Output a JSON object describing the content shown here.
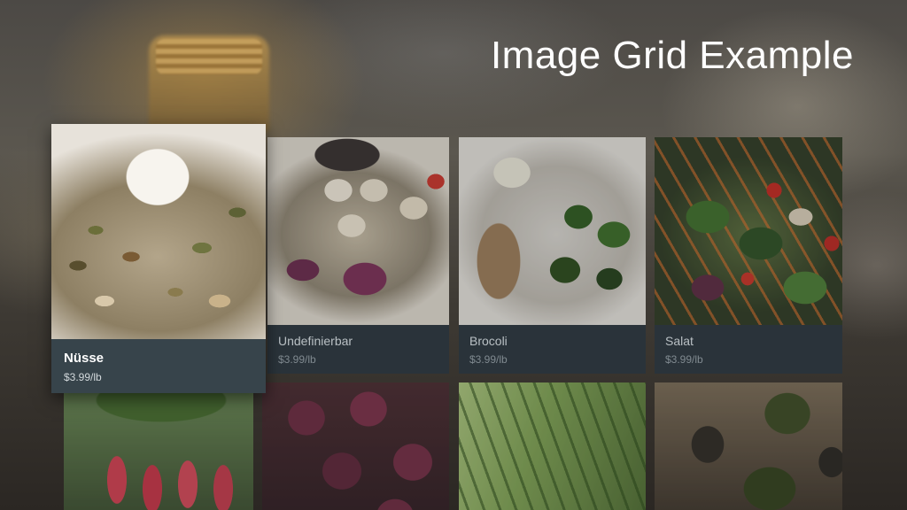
{
  "page": {
    "title": "Image Grid Example"
  },
  "grid": {
    "items": [
      {
        "title": "Nüsse",
        "price": "$3.99/lb",
        "image": "nuts-cheese-photo",
        "focused": true
      },
      {
        "title": "Undefinierbar",
        "price": "$3.99/lb",
        "image": "scallop-salad-photo",
        "focused": false
      },
      {
        "title": "Brocoli",
        "price": "$3.99/lb",
        "image": "brocoli-plate-photo",
        "focused": false
      },
      {
        "title": "Salat",
        "price": "$3.99/lb",
        "image": "salad-photo",
        "focused": false
      }
    ],
    "second_row_images": [
      "radish-photo",
      "red-onion-photo",
      "celery-photo",
      "avocado-photo"
    ]
  },
  "colors": {
    "focused_card_bg": "#37444b",
    "card_bg": "#2a333a",
    "title_text": "#ffffff"
  }
}
